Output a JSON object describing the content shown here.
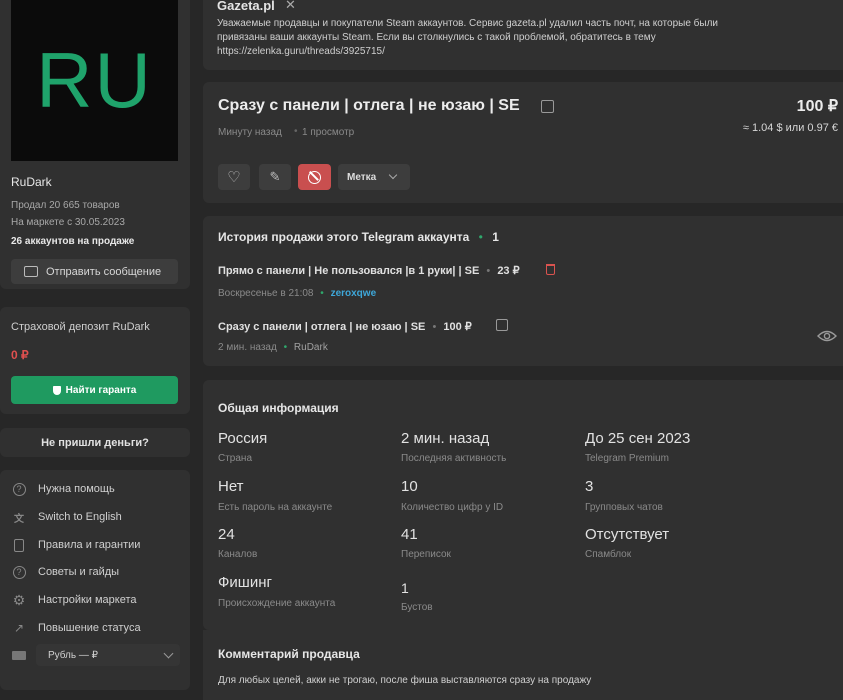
{
  "seller": {
    "avatar_text": "RU",
    "name": "RuDark",
    "sold": "Продал 20 665 товаров",
    "since": "На маркете с 30.05.2023",
    "on_sale": "26 аккаунтов на продаже",
    "message_button": "Отправить сообщение"
  },
  "deposit": {
    "title": "Страховой депозит RuDark",
    "amount": "0 ₽",
    "guarantor_button": "Найти гаранта"
  },
  "no_money_button": "Не пришли деньги?",
  "sidebar_menu": [
    {
      "label": "Нужна помощь",
      "icon": "question-icon"
    },
    {
      "label": "Switch to English",
      "icon": "language-icon"
    },
    {
      "label": "Правила и гарантии",
      "icon": "book-icon"
    },
    {
      "label": "Советы и гайды",
      "icon": "help-icon"
    },
    {
      "label": "Настройки маркета",
      "icon": "gear-icon"
    },
    {
      "label": "Повышение статуса",
      "icon": "trending-up-icon"
    }
  ],
  "currency_select": {
    "value": "Рубль — ₽"
  },
  "notice": {
    "title": "Gazeta.pl",
    "text_line1": "Уважаемые продавцы и покупатели Steam аккаунтов. Сервис gazeta.pl удалил часть почт, на которые были",
    "text_line2": "привязаны ваши аккаунты Steam. Если вы столкнулись с такой проблемой, обратитесь в тему",
    "link": "https://zelenka.guru/threads/3925715/"
  },
  "listing": {
    "title": "Сразу с панели | отлега | не юзаю | SE",
    "time": "Минуту назад",
    "views": "1 просмотр",
    "price": "100 ₽",
    "price_converted": "≈ 1.04 $ или 0.97 €",
    "tag_button": "Метка"
  },
  "history": {
    "title": "История продажи этого Telegram аккаунта",
    "count": "1",
    "items": [
      {
        "title": "Прямо с панели | Не пользовался |в 1 руки| | SE",
        "price": "23 ₽",
        "time": "Воскресенье в 21:08",
        "user": "zeroxqwe"
      },
      {
        "title": "Сразу с панели | отлега | не юзаю | SE",
        "price": "100 ₽",
        "time": "2 мин. назад",
        "user": "RuDark"
      }
    ]
  },
  "general": {
    "title": "Общая информация",
    "fields": [
      {
        "value": "Россия",
        "label": "Страна"
      },
      {
        "value": "2 мин. назад",
        "label": "Последняя активность"
      },
      {
        "value": "До 25 сен 2023",
        "label": "Telegram Premium"
      },
      {
        "value": "Нет",
        "label": "Есть пароль на аккаунте"
      },
      {
        "value": "10",
        "label": "Количество цифр у ID"
      },
      {
        "value": "3",
        "label": "Групповых чатов"
      },
      {
        "value": "24",
        "label": "Каналов"
      },
      {
        "value": "41",
        "label": "Переписок"
      },
      {
        "value": "Отсутствует",
        "label": "Спамблок"
      },
      {
        "value": "Фишинг",
        "label": "Происхождение аккаунта"
      },
      {
        "value": "1",
        "label": "Бустов"
      }
    ]
  },
  "comment": {
    "title": "Комментарий продавца",
    "text": "Для любых целей, акки не трогаю, после фиша выставляются сразу на продажу"
  },
  "colors": {
    "accent_green": "#1f9a60",
    "danger": "#c94f4f",
    "link_blue": "#3ea7d9"
  }
}
